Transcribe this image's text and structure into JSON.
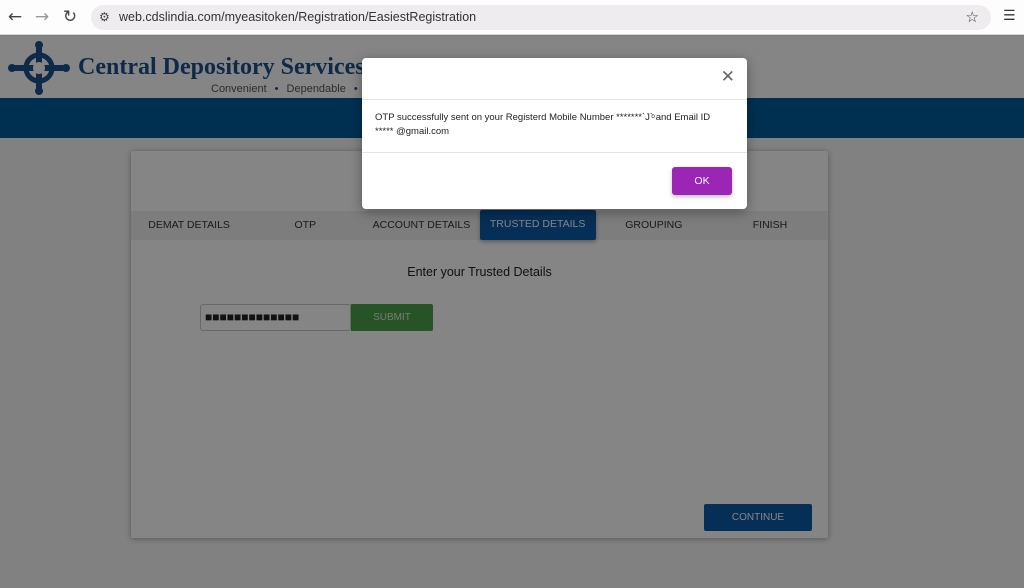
{
  "browser": {
    "back_icon": "back-arrow-icon",
    "forward_icon": "forward-arrow-icon",
    "reload_icon": "reload-icon",
    "url": "web.cdslindia.com/myeasitoken/Registration/EasiestRegistration",
    "bookmark_icon": "star-icon",
    "menu_icon": "reading-list-icon"
  },
  "site": {
    "brand": "Central Depository Services",
    "tagline": [
      "Convenient",
      "Dependable"
    ],
    "colors": {
      "brand_blue": "#1d4f8c",
      "bar_blue": "#005d9b",
      "accent_blue": "#0d5aa7",
      "submit_green": "#4aa14a",
      "ok_purple": "#9b26b6"
    }
  },
  "steps": [
    {
      "label": "DEMAT DETAILS",
      "active": false
    },
    {
      "label": "OTP",
      "active": false
    },
    {
      "label": "ACCOUNT DETAILS",
      "active": false
    },
    {
      "label": "TRUSTED DETAILS",
      "active": true
    },
    {
      "label": "GROUPING",
      "active": false
    },
    {
      "label": "FINISH",
      "active": false
    }
  ],
  "form": {
    "heading": "Enter your Trusted Details",
    "input_value": "■■■■■■■■■■■■■",
    "submit_label": "SUBMIT",
    "continue_label": "CONTINUE"
  },
  "modal": {
    "close_icon": "close-icon",
    "message_line1": "OTP successfully sent on your Registerd Mobile Number *******`J`ͦ and Email ID",
    "message_line2": "*****        @gmail.com",
    "ok_label": "OK"
  }
}
